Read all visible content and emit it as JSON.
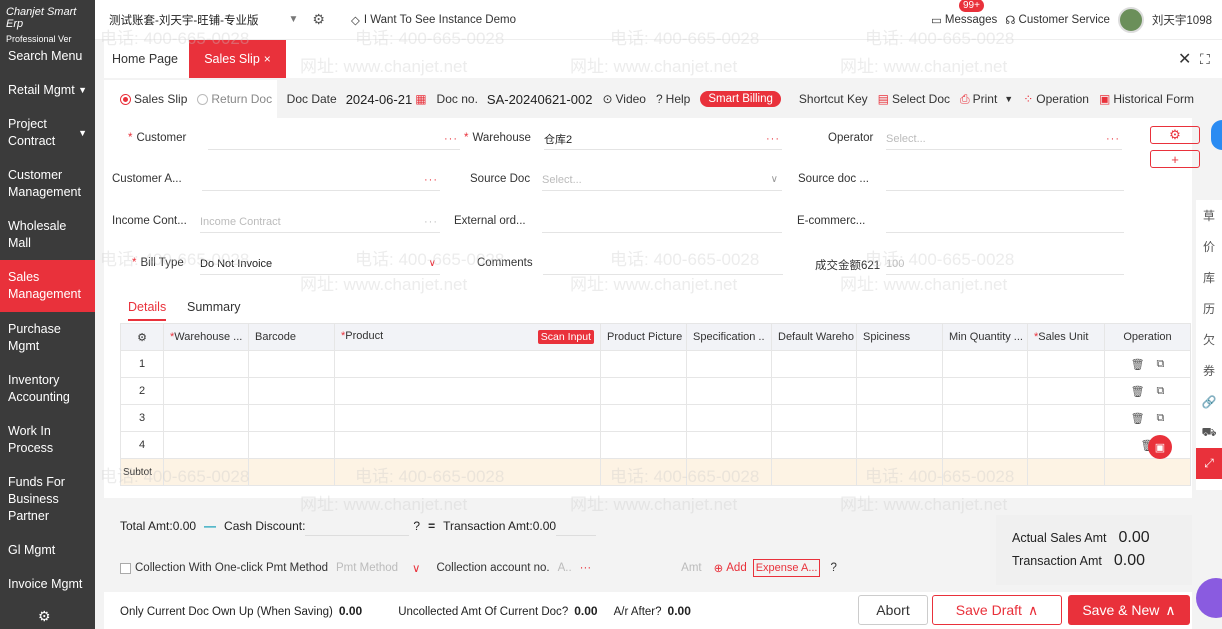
{
  "sidebar": {
    "brand": "Chanjet Smart Erp",
    "edition": "Professional Ver",
    "items": [
      {
        "label": "Search Menu"
      },
      {
        "label": "Retail Mgmt"
      },
      {
        "label": "Project Contract"
      },
      {
        "label": "Customer Management"
      },
      {
        "label": "Wholesale Mall"
      },
      {
        "label": "Sales Management"
      },
      {
        "label": "Purchase Mgmt"
      },
      {
        "label": "Inventory Accounting"
      },
      {
        "label": "Work In Process"
      },
      {
        "label": "Funds For Business Partner"
      },
      {
        "label": "Gl Mgmt"
      },
      {
        "label": "Invoice Mgmt"
      }
    ]
  },
  "topbar": {
    "account": "测试账套-刘天宇-旺铺-专业版",
    "demo_link": "I Want To See Instance Demo",
    "messages_label": "Messages",
    "messages_badge": "99+",
    "customer_service": "Customer Service",
    "username": "刘天宇1098"
  },
  "tabs": {
    "home": "Home Page",
    "active": "Sales Slip"
  },
  "toolbar": {
    "radio_sales_slip": "Sales Slip",
    "radio_return_doc": "Return Doc",
    "doc_date_label": "Doc Date",
    "doc_date_value": "2024-06-21",
    "doc_no_label": "Doc no.",
    "doc_no_value": "SA-20240621-002",
    "video": "Video",
    "help": "Help",
    "smart_billing": "Smart Billing",
    "shortcut_key": "Shortcut Key",
    "select_doc": "Select Doc",
    "print": "Print",
    "operation": "Operation",
    "historical_form": "Historical Form"
  },
  "form": {
    "customer_label": "Customer",
    "warehouse_label": "Warehouse",
    "warehouse_value": "仓库2",
    "operator_label": "Operator",
    "operator_placeholder": "Select...",
    "customer_account_label": "Customer A...",
    "source_doc_label": "Source Doc",
    "source_doc_placeholder": "Select...",
    "source_doc_no_label": "Source doc ...",
    "income_contract_label": "Income Cont...",
    "income_contract_placeholder": "Income Contract",
    "external_order_label": "External ord...",
    "ecommerce_label": "E-commerc...",
    "bill_type_label": "Bill Type",
    "bill_type_value": "Do Not Invoice",
    "comments_label": "Comments",
    "deal_amount_label": "成交金额621",
    "deal_amount_value": "100"
  },
  "detail_tabs": [
    "Details",
    "Summary"
  ],
  "grid": {
    "columns": [
      "",
      "Warehouse ...",
      "Barcode",
      "Product",
      "Product Picture",
      "Specification ..",
      "Default Wareho",
      "Spiciness",
      "Min Quantity ...",
      "Sales Unit",
      "Operation"
    ],
    "scan_input": "Scan Input",
    "rows": [
      "1",
      "2",
      "3",
      "4"
    ],
    "subtotal_label": "Subtot"
  },
  "summary": {
    "total_amt": "Total Amt:0.00",
    "cash_discount": "Cash Discount:",
    "transaction_amt": "Transaction Amt:0.00",
    "collection_checkbox": "Collection With One-click Pmt Method",
    "pmt_method_placeholder": "Pmt Method",
    "collection_account": "Collection account no.",
    "collection_account_placeholder": "A..",
    "amt_placeholder": "Amt",
    "add": "Add",
    "expense": "Expense A..."
  },
  "totals": {
    "actual_sales_label": "Actual Sales Amt",
    "actual_sales_value": "0.00",
    "transaction_label": "Transaction Amt",
    "transaction_value": "0.00"
  },
  "footer": {
    "own_up_label": "Only Current Doc Own Up (When Saving)",
    "own_up_value": "0.00",
    "uncollected_label": "Uncollected Amt Of Current Doc",
    "uncollected_value": "0.00",
    "ar_after_label": "A/r After",
    "ar_after_value": "0.00",
    "abort": "Abort",
    "save_draft": "Save Draft",
    "save_new": "Save & New"
  },
  "rail_icons": [
    "草",
    "价",
    "库",
    "历",
    "欠",
    "券",
    "link-icon",
    "truck-icon",
    "expand-icon"
  ],
  "watermark": [
    "电话: 400-665-0028",
    "网址: www.chanjet.net"
  ],
  "colors": {
    "accent": "#e9313b",
    "sidebar": "#3b3b3b"
  }
}
